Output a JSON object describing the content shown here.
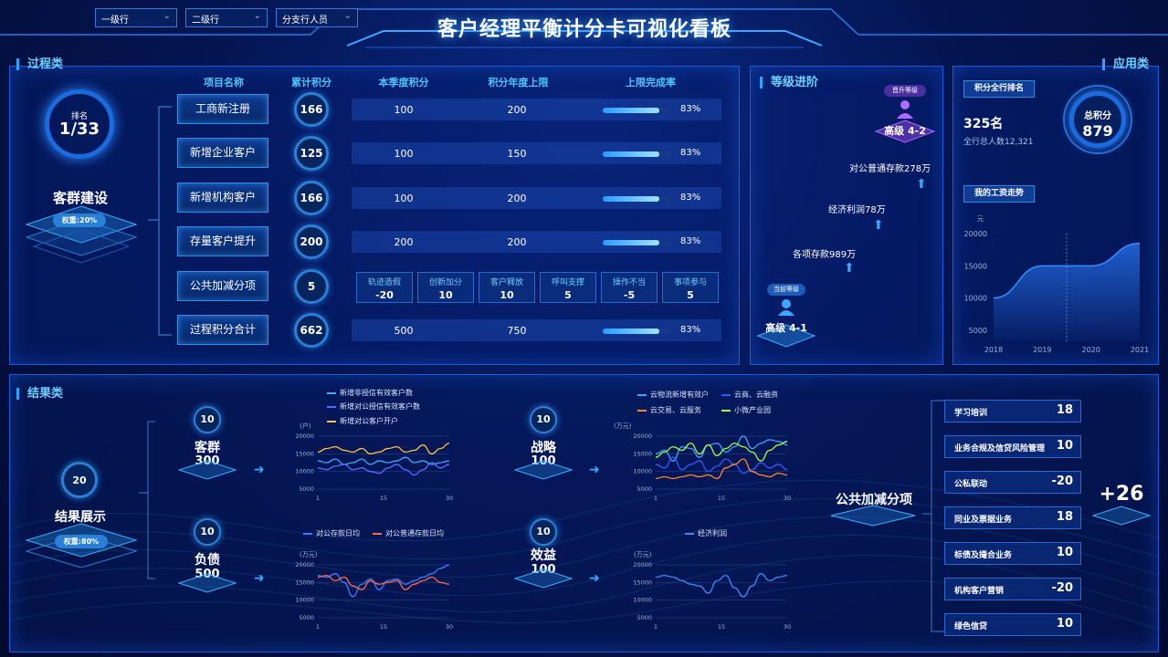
{
  "filters": [
    {
      "label": "一级行"
    },
    {
      "label": "二级行"
    },
    {
      "label": "分支行人员"
    }
  ],
  "title": "客户经理平衡计分卡可视化看板",
  "process": {
    "section": "过程类",
    "rank_label": "排名",
    "rank_value": "1/33",
    "group_name": "客群建设",
    "weight": "权重:20%",
    "headers": [
      "项目名称",
      "累计积分",
      "本季度积分",
      "积分年度上限",
      "上限完成率"
    ],
    "rows": [
      {
        "name": "工商新注册",
        "total": "166",
        "quarter": "100",
        "cap": "200",
        "rate": "83%",
        "fill": 0.83
      },
      {
        "name": "新增企业客户",
        "total": "125",
        "quarter": "100",
        "cap": "150",
        "rate": "83%",
        "fill": 0.83
      },
      {
        "name": "新增机构客户",
        "total": "166",
        "quarter": "100",
        "cap": "200",
        "rate": "83%",
        "fill": 0.83
      },
      {
        "name": "存量客户提升",
        "total": "200",
        "quarter": "200",
        "cap": "200",
        "rate": "83%",
        "fill": 0.83
      },
      {
        "name": "公共加减分项",
        "total": "5"
      },
      {
        "name": "过程积分合计",
        "total": "662",
        "quarter": "500",
        "cap": "750",
        "rate": "83%",
        "fill": 0.83
      }
    ],
    "adjust": [
      {
        "label": "轨迹造假",
        "value": "-20"
      },
      {
        "label": "创新加分",
        "value": "10"
      },
      {
        "label": "客户释放",
        "value": "10"
      },
      {
        "label": "呼叫支撑",
        "value": "5"
      },
      {
        "label": "操作不当",
        "value": "-5"
      },
      {
        "label": "事项参与",
        "value": "5"
      }
    ]
  },
  "grade": {
    "section": "等级进阶",
    "promote_tag": "晋升等级",
    "promote_level": "高级 4-2",
    "current_tag": "当前等级",
    "current_level": "高级 4-1",
    "steps": [
      "各项存款989万",
      "经济利润78万",
      "对公普通存款278万"
    ]
  },
  "app": {
    "section": "应用类",
    "rank_title": "积分全行排名",
    "rank": "325名",
    "total_people": "全行总人数12,321",
    "score_label": "总积分",
    "score": "879",
    "salary_title": "我的工资走势",
    "unit": "元",
    "chart_data": {
      "type": "area",
      "x": [
        "2018",
        "2019",
        "2020",
        "2021"
      ],
      "values": [
        10000,
        15000,
        15000,
        18500
      ],
      "ylim": [
        5000,
        20000
      ],
      "yticks": [
        "20000",
        "15000",
        "10000",
        "5000"
      ]
    }
  },
  "result": {
    "section": "结果类",
    "score": "20",
    "name": "结果展示",
    "weight": "权重:80%",
    "groups": [
      {
        "badge": "10",
        "name": "客群",
        "value": "300"
      },
      {
        "badge": "10",
        "name": "负债",
        "value": "500"
      },
      {
        "badge": "10",
        "name": "战略",
        "value": "100"
      },
      {
        "badge": "10",
        "name": "效益",
        "value": "100"
      }
    ],
    "chart_data": [
      {
        "type": "line",
        "ylabel": "(户)",
        "x_ticks": [
          "1",
          "15",
          "30"
        ],
        "yticks": [
          "20000",
          "15000",
          "10000",
          "5000"
        ],
        "ylim": [
          5000,
          20000
        ],
        "series": [
          {
            "name": "新增非授信有效客户数",
            "color": "#3aa8ff",
            "values": [
              13000,
              12500,
              13500,
              12000,
              12500,
              13500,
              12000,
              13000,
              12500,
              13000,
              14000,
              12500,
              13000,
              12000,
              12500,
              13000
            ]
          },
          {
            "name": "新增对公授信有效客户数",
            "color": "#5a6cff",
            "values": [
              11000,
              10500,
              11500,
              12000,
              10500,
              11000,
              10000,
              9500,
              11000,
              12000,
              10500,
              9000,
              10500,
              12500,
              11000,
              12000
            ]
          },
          {
            "name": "新增对公客户开户",
            "color": "#ffc83a",
            "values": [
              15500,
              16500,
              17000,
              16000,
              15500,
              16500,
              15000,
              15500,
              16500,
              17000,
              15500,
              16000,
              17500,
              15000,
              16500,
              18000
            ]
          }
        ]
      },
      {
        "type": "line",
        "ylabel": "(万元)",
        "x_ticks": [
          "1",
          "15",
          "30"
        ],
        "yticks": [
          "20000",
          "15000",
          "10000",
          "5000"
        ],
        "ylim": [
          5000,
          20000
        ],
        "series": [
          {
            "name": "对公存款日均",
            "color": "#3a7dff",
            "values": [
              17000,
              16500,
              17500,
              15000,
              11000,
              14500,
              16000,
              13000,
              15500,
              16000,
              14500,
              15500,
              16500,
              17500,
              19000,
              20000
            ]
          },
          {
            "name": "对公普通存款日均",
            "color": "#ff6a50",
            "values": [
              16500,
              17000,
              15500,
              16500,
              14000,
              13000,
              15500,
              14500,
              15000,
              15500,
              13000,
              14500,
              15500,
              16500,
              15000,
              14500
            ]
          }
        ]
      },
      {
        "type": "line",
        "ylabel": "(万元)",
        "x_ticks": [
          "1",
          "15",
          "30"
        ],
        "yticks": [
          "20000",
          "15000",
          "10000",
          "5000"
        ],
        "ylim": [
          5000,
          20000
        ],
        "series": [
          {
            "name": "云物流新增有效户",
            "color": "#3aa8ff",
            "values": [
              15000,
              16000,
              13000,
              17000,
              16500,
              14000,
              17500,
              18000,
              15500,
              17000,
              20000,
              16500,
              18000,
              19000,
              18500,
              17500
            ]
          },
          {
            "name": "云商、云融资",
            "color": "#2f5bff",
            "values": [
              12000,
              11000,
              14000,
              10500,
              12000,
              13000,
              10000,
              11500,
              13500,
              12000,
              9500,
              10500,
              12500,
              11000,
              12000,
              10500
            ]
          },
          {
            "name": "云交易、云服务",
            "color": "#ff8a2a",
            "values": [
              8000,
              8500,
              8000,
              8500,
              9000,
              8500,
              9000,
              8000,
              11000,
              12000,
              13500,
              10000,
              9000,
              8500,
              9500,
              9000
            ]
          },
          {
            "name": "小微产业园",
            "color": "#a4ff3a",
            "values": [
              14000,
              15500,
              17000,
              16000,
              18000,
              15000,
              17500,
              14500,
              16500,
              18000,
              17000,
              15500,
              13000,
              16000,
              17500,
              18500
            ]
          }
        ]
      },
      {
        "type": "line",
        "ylabel": "(万元)",
        "x_ticks": [
          "1",
          "15",
          "30"
        ],
        "yticks": [
          "20000",
          "15000",
          "10000",
          "5000"
        ],
        "ylim": [
          5000,
          20000
        ],
        "series": [
          {
            "name": "经济利润",
            "color": "#3a8dff",
            "values": [
              16500,
              17000,
              16500,
              15500,
              14500,
              14000,
              12000,
              15500,
              17000,
              13500,
              11000,
              14000,
              17500,
              15500,
              16500,
              17000
            ]
          }
        ]
      }
    ],
    "public": {
      "name": "公共加减分项",
      "total": "+26"
    },
    "items": [
      {
        "label": "学习培训",
        "value": "18"
      },
      {
        "label": "业务合规及信贷风险管理",
        "value": "10"
      },
      {
        "label": "公私联动",
        "value": "-20"
      },
      {
        "label": "同业及票据业务",
        "value": "18"
      },
      {
        "label": "标债及撮合业务",
        "value": "10"
      },
      {
        "label": "机构客户营销",
        "value": "-20"
      },
      {
        "label": "绿色信贷",
        "value": "10"
      }
    ]
  }
}
